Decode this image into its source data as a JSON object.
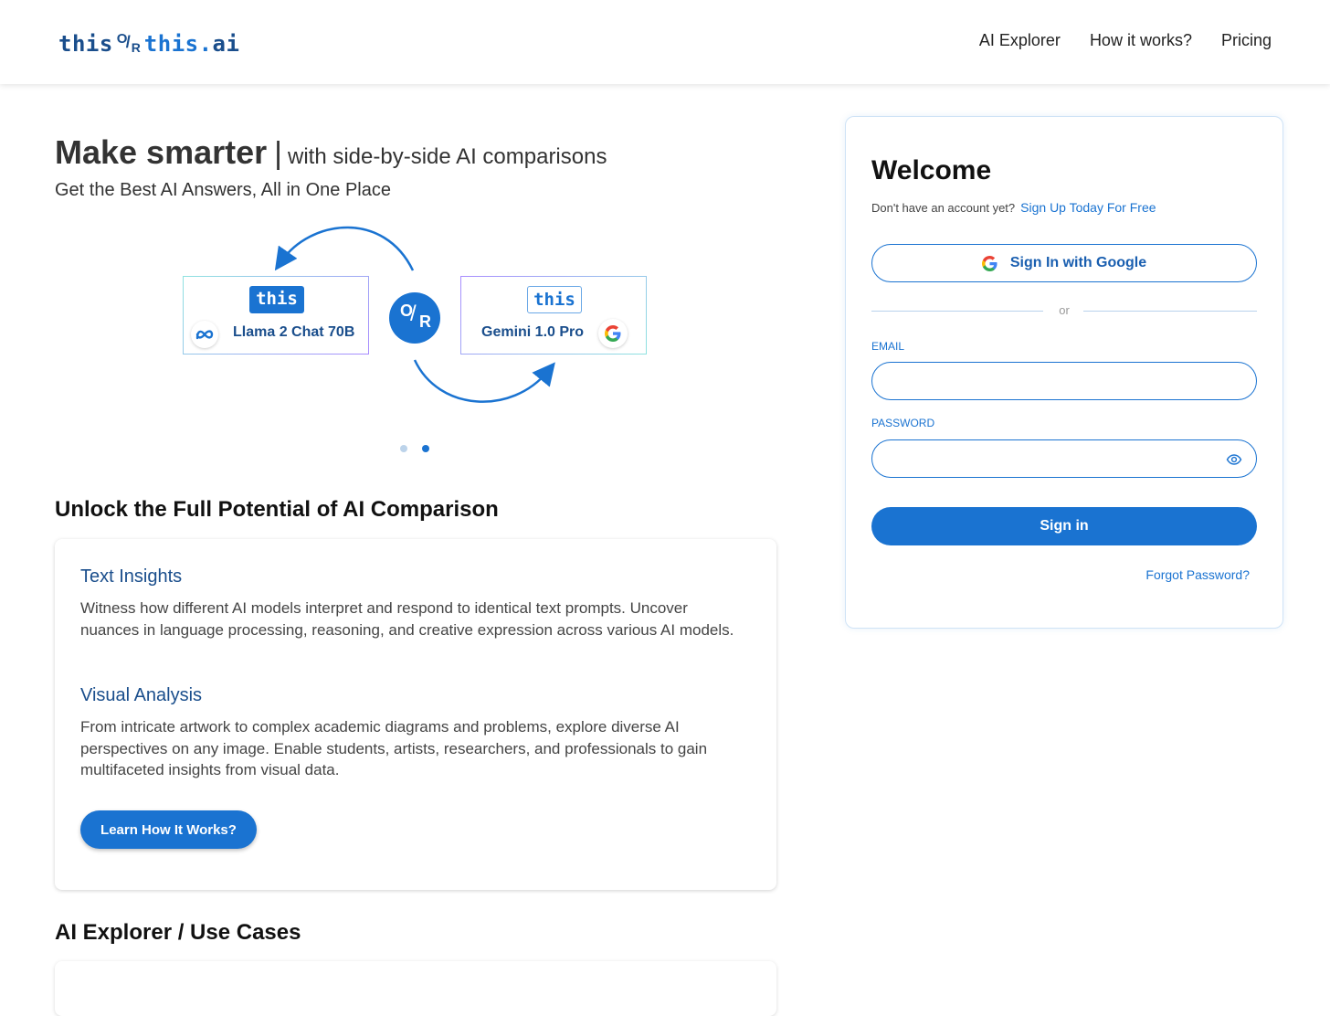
{
  "header": {
    "logo": {
      "left": "this",
      "or_o": "O",
      "or_slash": "/",
      "or_r": "R",
      "right": "this",
      "dot": ".",
      "suffix": "ai"
    },
    "nav": [
      "AI Explorer",
      "How it works?",
      "Pricing"
    ]
  },
  "hero": {
    "title": "Make smarter",
    "divider": "|",
    "tagline": "with side-by-side AI comparisons",
    "subtitle": "Get the Best AI Answers, All in One Place"
  },
  "comparison": {
    "left": {
      "tag": "this",
      "model": "Llama 2 Chat 70B",
      "icon": "meta-icon"
    },
    "right": {
      "tag": "this",
      "model": "Gemini 1.0 Pro",
      "icon": "google-icon"
    },
    "badge": {
      "o": "O",
      "slash": "/",
      "r": "R"
    },
    "carousel": {
      "total": 2,
      "active": 2
    }
  },
  "features": {
    "section_title": "Unlock the Full Potential of AI Comparison",
    "items": [
      {
        "title": "Text Insights",
        "body": "Witness how different AI models interpret and respond to identical text prompts. Uncover nuances in language processing, reasoning, and creative expression across various AI models."
      },
      {
        "title": "Visual Analysis",
        "body": "From intricate artwork to complex academic diagrams and problems, explore diverse AI perspectives on any image. Enable students, artists, researchers, and professionals to gain multifaceted insights from visual data."
      }
    ],
    "cta": "Learn How It Works?"
  },
  "explorer": {
    "section_title": "AI Explorer / Use Cases"
  },
  "login": {
    "title": "Welcome",
    "no_account": "Don't have an account yet?",
    "signup_link": "Sign Up Today For Free",
    "google_button": "Sign In with Google",
    "or": "or",
    "email_label": "EMAIL",
    "email_value": "",
    "password_label": "PASSWORD",
    "password_value": "",
    "signin_button": "Sign in",
    "forgot": "Forgot Password?"
  },
  "colors": {
    "primary": "#1a73d1",
    "brand_dark": "#1a4e8c",
    "text": "#333333"
  }
}
